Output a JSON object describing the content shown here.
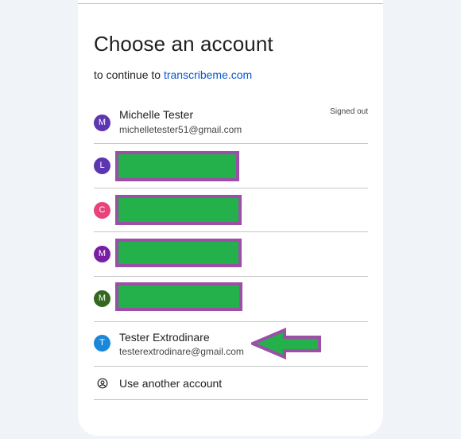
{
  "header": {
    "title": "Choose an account",
    "subtitle_prefix": "to continue to",
    "subtitle_link": "transcribeme.com"
  },
  "accounts": [
    {
      "initial": "M",
      "name": "Michelle Tester",
      "email": "michelletester51@gmail.com",
      "status": "Signed out",
      "avatar_color": "#5e35b1"
    },
    {
      "initial": "L",
      "avatar_color": "#5e35b1",
      "redacted": true
    },
    {
      "initial": "C",
      "avatar_color": "#e8437a",
      "redacted": true
    },
    {
      "initial": "M",
      "avatar_color": "#7b1fa2",
      "redacted": true
    },
    {
      "initial": "M",
      "avatar_color": "#33691e",
      "redacted": true
    },
    {
      "initial": "T",
      "name": "Tester Extrodinare",
      "email": "testerextrodinare@gmail.com",
      "avatar_color": "#1a88d8"
    }
  ],
  "use_another": {
    "label": "Use another account",
    "icon": "account-circle-icon"
  },
  "annotation": {
    "icon": "left-arrow-icon",
    "fill": "#24b14c",
    "stroke": "#9b4fa6"
  },
  "colors": {
    "link": "#0b57d0",
    "divider": "#c4c7c5",
    "background": "#f0f4f9",
    "redaction_fill": "#24b14c",
    "redaction_border": "#9b4fa6"
  }
}
